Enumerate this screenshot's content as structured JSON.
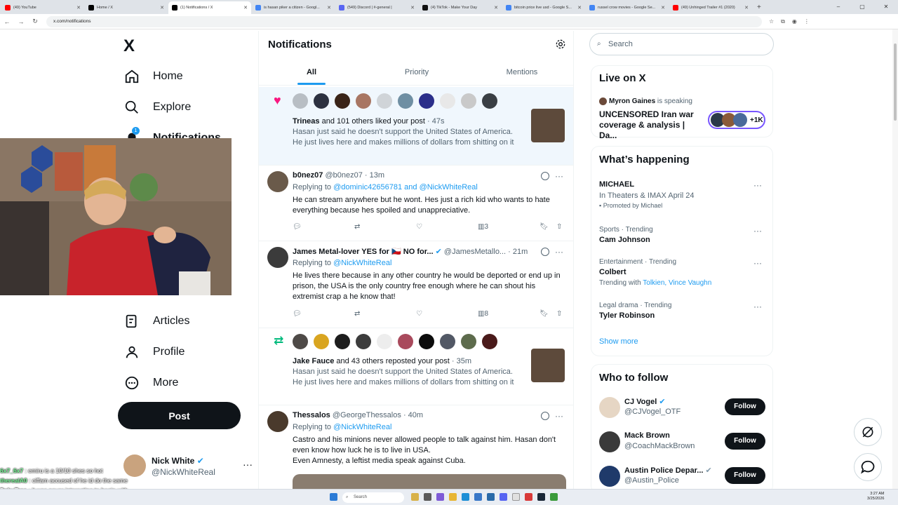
{
  "browser": {
    "tabs": [
      {
        "title": "(49) YouTube",
        "color": "#ff0000"
      },
      {
        "title": "Home / X",
        "color": "#000000"
      },
      {
        "title": "(1) Notifications / X",
        "color": "#000000",
        "active": true
      },
      {
        "title": "is hasan piker a citizen - Googl...",
        "color": "#4285f4"
      },
      {
        "title": "(549) Discord | #-general |",
        "color": "#5865f2"
      },
      {
        "title": "(4) TikTok - Make Your Day",
        "color": "#111111"
      },
      {
        "title": "bitcoin price live usd - Google S...",
        "color": "#4285f4"
      },
      {
        "title": "russel crow movies - Google Se...",
        "color": "#4285f4"
      },
      {
        "title": "(49) Unhinged Trailer #1 (2020)",
        "color": "#ff0000"
      }
    ],
    "new_tab": "+",
    "url": "x.com/notifications",
    "win_min": "–",
    "win_max": "▢",
    "win_close": "✕"
  },
  "sidebar": {
    "logo": "X",
    "items": [
      {
        "label": "Home",
        "icon": "home-icon"
      },
      {
        "label": "Explore",
        "icon": "search-icon"
      },
      {
        "label": "Notifications",
        "icon": "bell-icon",
        "badge": "1"
      },
      {
        "label": "Articles",
        "icon": "articles-icon"
      },
      {
        "label": "Profile",
        "icon": "person-icon"
      },
      {
        "label": "More",
        "icon": "more-circle-icon"
      }
    ],
    "post_label": "Post",
    "me": {
      "name": "Nick White",
      "handle": "@NickWhiteReal",
      "more": "···"
    }
  },
  "main": {
    "title": "Notifications",
    "tabs": [
      "All",
      "Priority",
      "Mentions"
    ],
    "notif1": {
      "actor": "Trineas",
      "action": " and 101 others liked your post",
      "time": " · 47s",
      "text": "Hasan just said he doesn't support the United States of America. He just lives here and makes millions of dollars from shitting on it"
    },
    "tweet1": {
      "name": "b0nez07",
      "handle": "@b0nez07",
      "time": "· 13m",
      "replying": "Replying to ",
      "to": "@dominic42656781 and @NickWhiteReal",
      "text": "He can stream anywhere but he wont. Hes just a rich kid who wants to hate everything because hes spoiled and unappreciative.",
      "views": "3"
    },
    "tweet2": {
      "name": "James Metal-lover YES for 🇨🇿 NO for...",
      "handle": "@JamesMetallo...",
      "time": "· 21m",
      "replying": "Replying to ",
      "to": "@NickWhiteReal",
      "text": "He lives there because in any other country he would be deported or end up in prison, the USA is the only country free enough where he can shout his extremist crap a he know that!",
      "views": "8"
    },
    "notif2": {
      "actor": "Jake Fauce",
      "action": " and 43 others reposted your post",
      "time": " · 35m",
      "text": "Hasan just said he doesn't support the United States of America. He just lives here and makes millions of dollars from shitting on it"
    },
    "tweet3": {
      "name": "Thessalos",
      "handle": "@GeorgeThessalos",
      "time": "· 40m",
      "replying": "Replying to ",
      "to": "@NickWhiteReal",
      "text": "Castro and his minions never allowed people to talk against him. Hasan don't even know how luck he is to live in USA.\nEven Amnesty, a leftist media speak against Cuba."
    }
  },
  "right": {
    "search_placeholder": "Search",
    "live": {
      "title": "Live on X",
      "host": "Myron Gaines",
      "host_status": " is speaking",
      "headline": "UNCENSORED Iran war coverage & analysis | Da...",
      "count": "+1K"
    },
    "happening": {
      "title": "What’s happening",
      "trends": [
        {
          "category": "",
          "name": "MICHAEL",
          "extra": "In Theaters & IMAX April 24",
          "promo": "Promoted by Michael"
        },
        {
          "category": "Sports · Trending",
          "name": "Cam Johnson",
          "extra": ""
        },
        {
          "category": "Entertainment · Trending",
          "name": "Colbert",
          "extra": "Trending with ",
          "links": "Tolkien, Vince Vaughn"
        },
        {
          "category": "Legal drama · Trending",
          "name": "Tyler Robinson",
          "extra": ""
        }
      ],
      "show_more": "Show more"
    },
    "who": {
      "title": "Who to follow",
      "people": [
        {
          "name": "CJ Vogel",
          "handle": "@CJVogel_OTF",
          "btn": "Follow"
        },
        {
          "name": "Mack Brown",
          "handle": "@CoachMackBrown",
          "btn": "Follow"
        },
        {
          "name": "Austin Police Depar...",
          "handle": "@Austin_Police",
          "btn": "Follow"
        }
      ]
    }
  },
  "chat": [
    {
      "user": "6x7_6x7",
      "msg": " : emiru is a 10/10 shes so hot"
    },
    {
      "user": "therealA0",
      "msg": " : ciffam accused of he id do the same"
    },
    {
      "user": "DekuTree",
      "msg": " : it was never interesting to begin with"
    }
  ],
  "taskbar": {
    "search": "Search",
    "time": "3:27 AM",
    "date": "3/25/2026"
  }
}
